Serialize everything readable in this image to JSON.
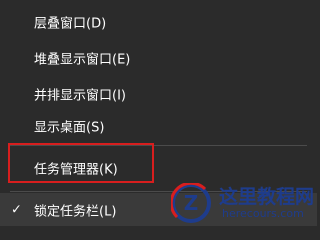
{
  "menu": {
    "items": [
      {
        "label": "层叠窗口(D)"
      },
      {
        "label": "堆叠显示窗口(E)"
      },
      {
        "label": "并排显示窗口(I)"
      },
      {
        "label": "显示桌面(S)"
      },
      {
        "label": "任务管理器(K)"
      },
      {
        "label": "锁定任务栏(L)",
        "checked": true
      }
    ]
  },
  "highlight": {
    "color": "#d81e1e",
    "target": "任务管理器(K)"
  },
  "watermark": {
    "title": "这里教程网",
    "url": "herecours.com",
    "logo_letter": "Z",
    "color": "#1e3c8c"
  }
}
